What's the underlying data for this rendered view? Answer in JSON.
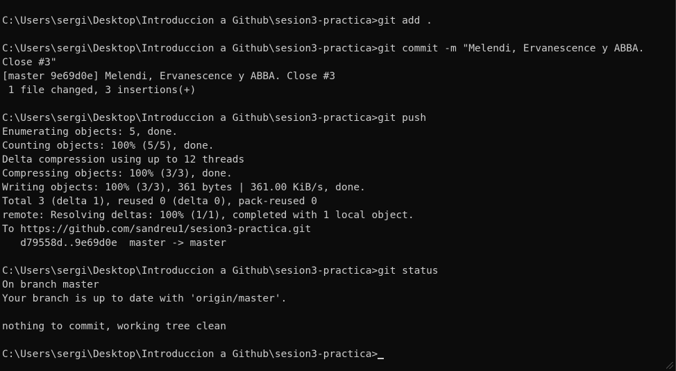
{
  "terminal": {
    "lines": [
      "C:\\Users\\sergi\\Desktop\\Introduccion a Github\\sesion3-practica>git add .",
      "",
      "C:\\Users\\sergi\\Desktop\\Introduccion a Github\\sesion3-practica>git commit -m \"Melendi, Ervanescence y ABBA.",
      "Close #3\"",
      "[master 9e69d0e] Melendi, Ervanescence y ABBA. Close #3",
      " 1 file changed, 3 insertions(+)",
      "",
      "C:\\Users\\sergi\\Desktop\\Introduccion a Github\\sesion3-practica>git push",
      "Enumerating objects: 5, done.",
      "Counting objects: 100% (5/5), done.",
      "Delta compression using up to 12 threads",
      "Compressing objects: 100% (3/3), done.",
      "Writing objects: 100% (3/3), 361 bytes | 361.00 KiB/s, done.",
      "Total 3 (delta 1), reused 0 (delta 0), pack-reused 0",
      "remote: Resolving deltas: 100% (1/1), completed with 1 local object.",
      "To https://github.com/sandreu1/sesion3-practica.git",
      "   d79558d..9e69d0e  master -> master",
      "",
      "C:\\Users\\sergi\\Desktop\\Introduccion a Github\\sesion3-practica>git status",
      "On branch master",
      "Your branch is up to date with 'origin/master'.",
      "",
      "nothing to commit, working tree clean",
      "",
      "C:\\Users\\sergi\\Desktop\\Introduccion a Github\\sesion3-practica>"
    ]
  },
  "colors": {
    "background": "#0c0c0c",
    "foreground": "#cccccc"
  }
}
